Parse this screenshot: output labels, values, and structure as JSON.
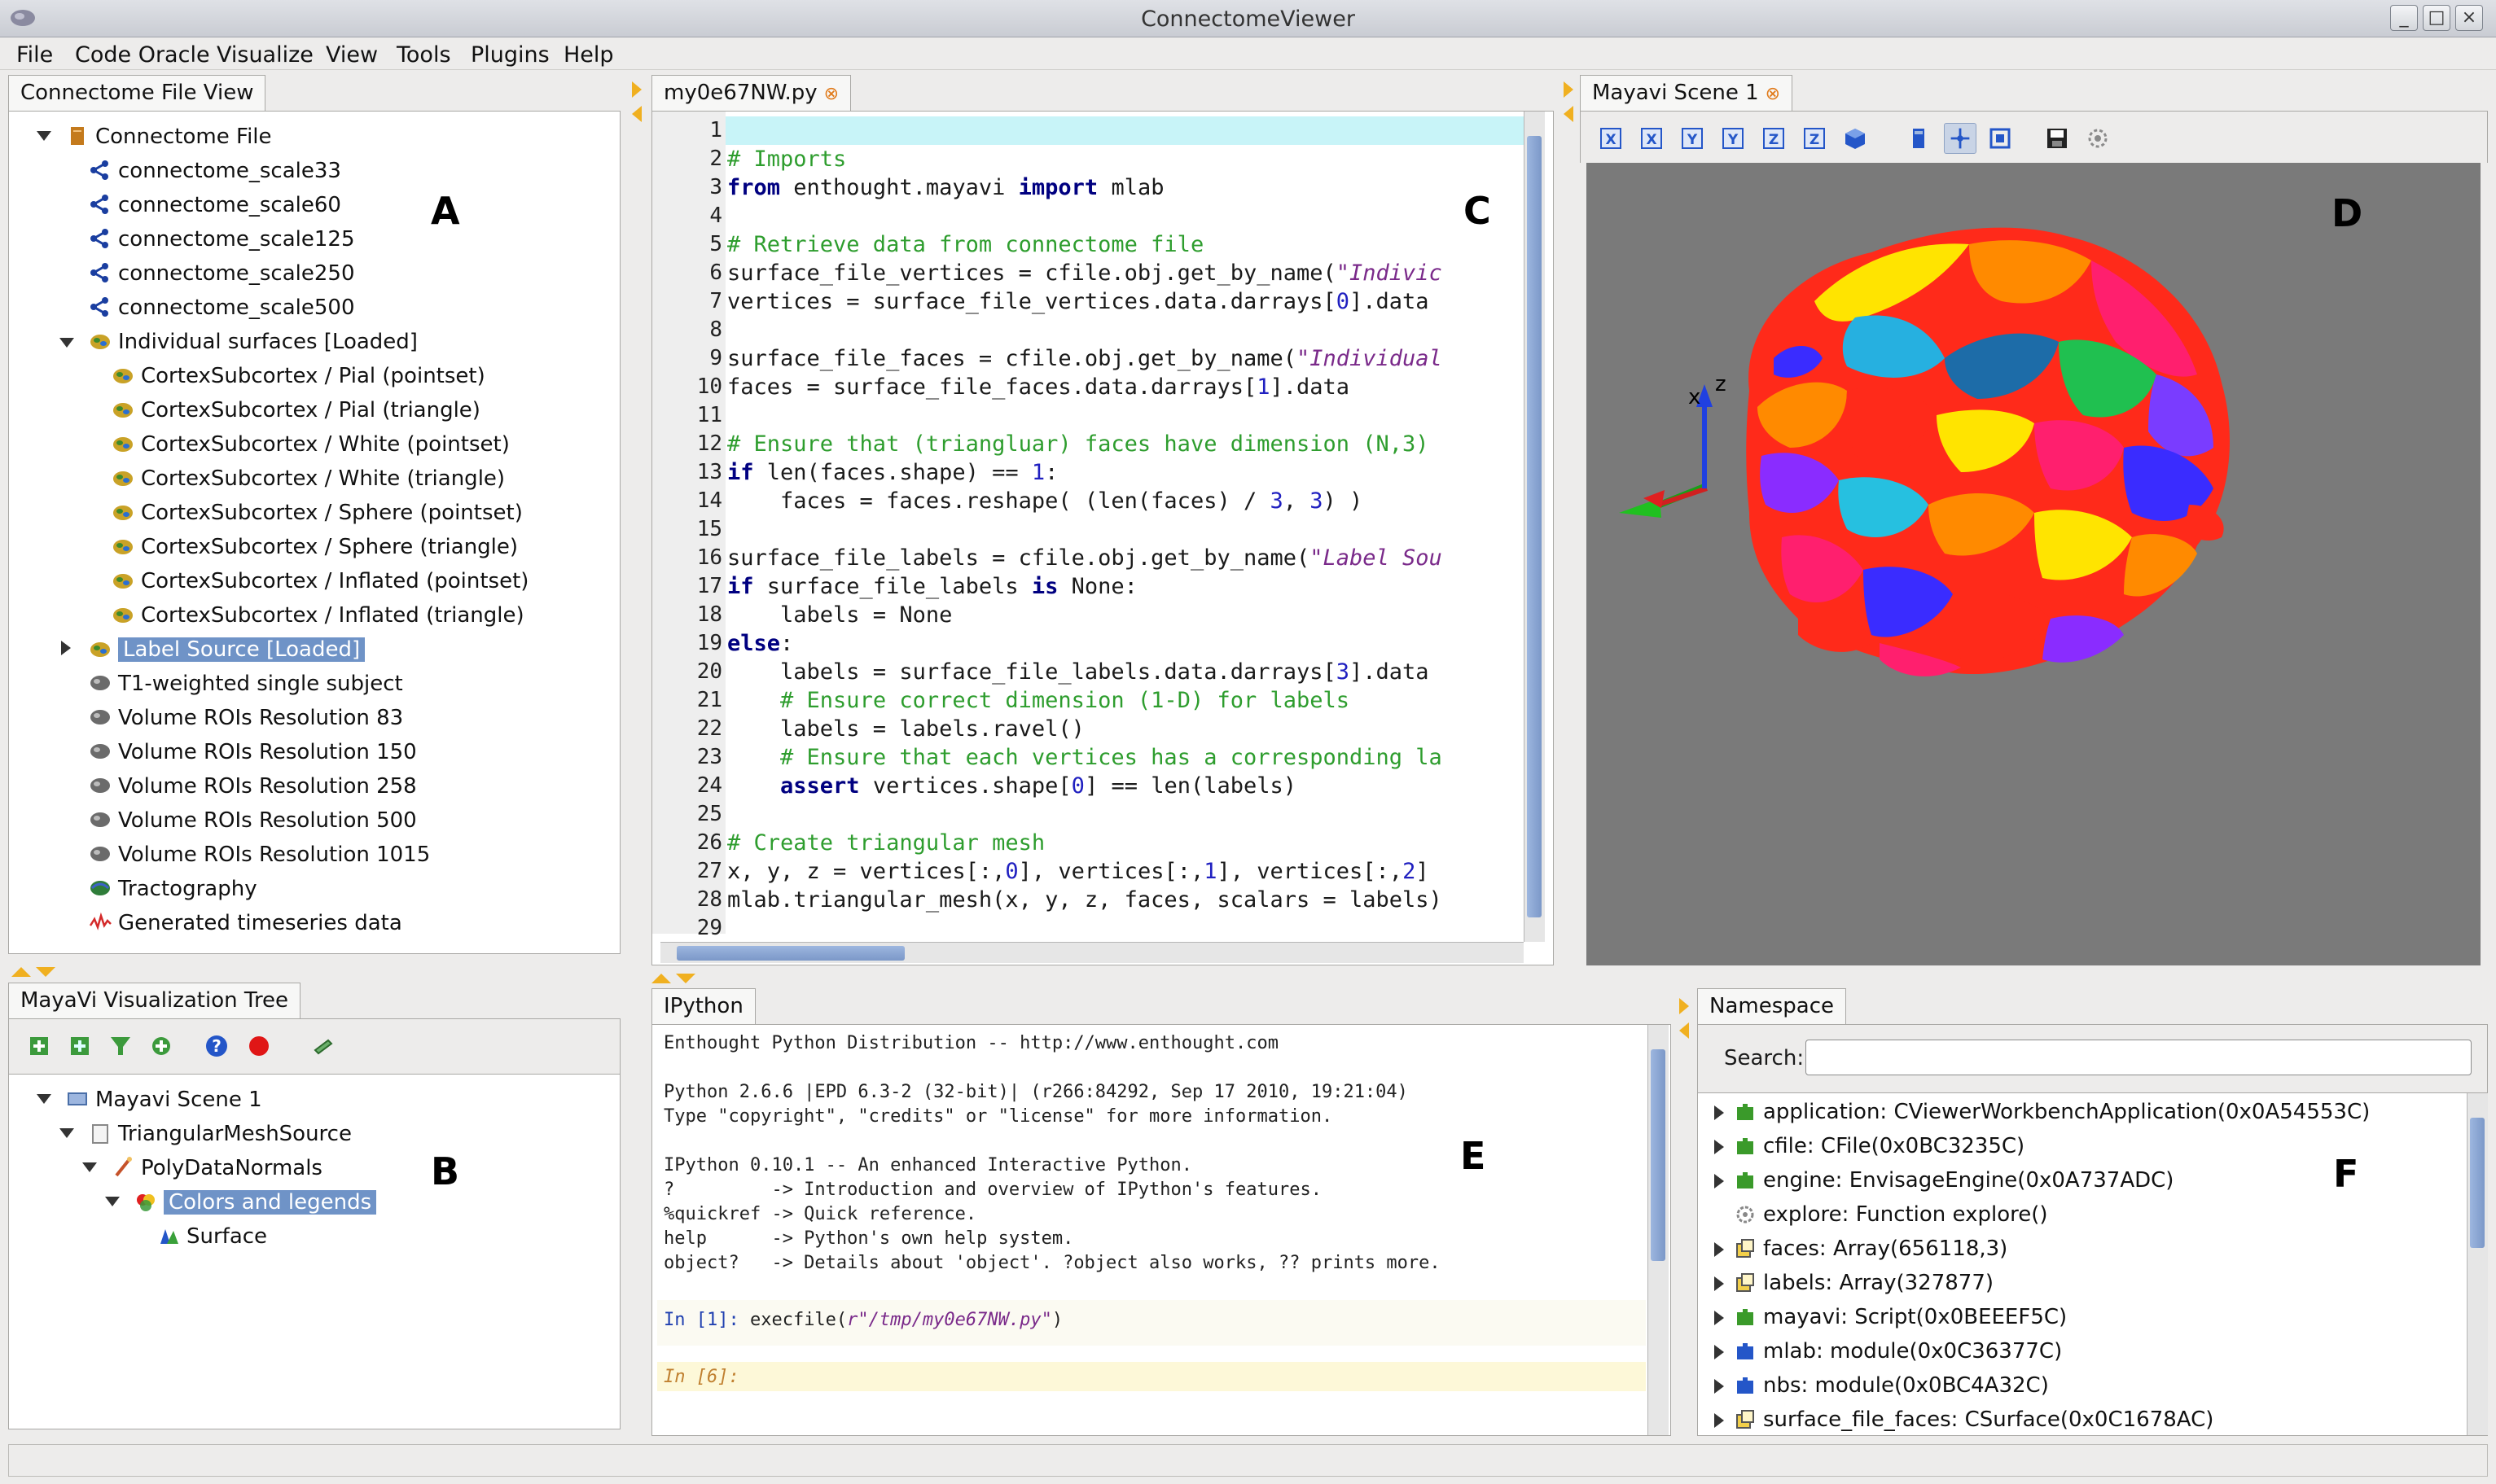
{
  "window": {
    "title": "ConnectomeViewer",
    "controls": [
      "_",
      "□",
      "×"
    ]
  },
  "menu": [
    "File",
    "Code Oracle",
    "Visualize",
    "View",
    "Tools",
    "Plugins",
    "Help"
  ],
  "panel_a": {
    "tab": "Connectome File View",
    "letter": "A",
    "root": "Connectome File",
    "networks": [
      "connectome_scale33",
      "connectome_scale60",
      "connectome_scale125",
      "connectome_scale250",
      "connectome_scale500"
    ],
    "surfaces_label": "Individual surfaces [Loaded]",
    "surfaces": [
      "CortexSubcortex / Pial (pointset)",
      "CortexSubcortex / Pial (triangle)",
      "CortexSubcortex / White (pointset)",
      "CortexSubcortex / White (triangle)",
      "CortexSubcortex / Sphere (pointset)",
      "CortexSubcortex / Sphere (triangle)",
      "CortexSubcortex / Inflated (pointset)",
      "CortexSubcortex / Inflated (triangle)"
    ],
    "label_source": "Label Source [Loaded]",
    "volumes": [
      "T1-weighted single subject",
      "Volume ROIs Resolution 83",
      "Volume ROIs Resolution 150",
      "Volume ROIs Resolution 258",
      "Volume ROIs Resolution 500",
      "Volume ROIs Resolution 1015"
    ],
    "tractography": "Tractography",
    "timeseries": "Generated timeseries data"
  },
  "panel_b": {
    "tab": "MayaVi Visualization Tree",
    "letter": "B",
    "items": [
      "Mayavi Scene 1",
      "TriangularMeshSource",
      "PolyDataNormals",
      "Colors and legends",
      "Surface"
    ]
  },
  "panel_c": {
    "tab": "my0e67NW.py",
    "tab_close": "⊗",
    "letter": "C",
    "line_numbers": [
      "1",
      "2",
      "3",
      "4",
      "5",
      "6",
      "7",
      "8",
      "9",
      "10",
      "11",
      "12",
      "13",
      "14",
      "15",
      "16",
      "17",
      "18",
      "19",
      "20",
      "21",
      "22",
      "23",
      "24",
      "25",
      "26",
      "27",
      "28",
      "29"
    ],
    "lines": [
      "",
      "# Imports",
      "from enthought.mayavi import mlab",
      "",
      "# Retrieve data from connectome file",
      "surface_file_vertices = cfile.obj.get_by_name(\"Indivic",
      "vertices = surface_file_vertices.data.darrays[0].data",
      "",
      "surface_file_faces = cfile.obj.get_by_name(\"Individual",
      "faces = surface_file_faces.data.darrays[1].data",
      "",
      "# Ensure that (triangluar) faces have dimension (N,3)",
      "if len(faces.shape) == 1:",
      "    faces = faces.reshape( (len(faces) / 3, 3) )",
      "",
      "surface_file_labels = cfile.obj.get_by_name(\"Label Sou",
      "if surface_file_labels is None:",
      "    labels = None",
      "else:",
      "    labels = surface_file_labels.data.darrays[3].data",
      "    # Ensure correct dimension (1-D) for labels",
      "    labels = labels.ravel()",
      "    # Ensure that each vertices has a corresponding la",
      "    assert vertices.shape[0] == len(labels)",
      "",
      "# Create triangular mesh",
      "x, y, z = vertices[:,0], vertices[:,1], vertices[:,2]",
      "mlab.triangular_mesh(x, y, z, faces, scalars = labels)",
      ""
    ]
  },
  "panel_d": {
    "tab": "Mayavi Scene 1",
    "tab_close": "⊗",
    "letter": "D",
    "axis_x": "x",
    "axis_z": "z"
  },
  "panel_e": {
    "tab": "IPython",
    "letter": "E",
    "lines": [
      "Enthought Python Distribution -- http://www.enthought.com",
      "",
      "Python 2.6.6 |EPD 6.3-2 (32-bit)| (r266:84292, Sep 17 2010, 19:21:04)",
      "Type \"copyright\", \"credits\" or \"license\" for more information.",
      "",
      "IPython 0.10.1 -- An enhanced Interactive Python.",
      "?         -> Introduction and overview of IPython's features.",
      "%quickref -> Quick reference.",
      "help      -> Python's own help system.",
      "object?   -> Details about 'object'. ?object also works, ?? prints more."
    ],
    "in1_prompt": "In [1]:",
    "in1_cmd": " execfile(",
    "in1_arg": "r\"/tmp/my0e67NW.py\"",
    "in1_close": ")",
    "in6_prompt": "In [6]:"
  },
  "panel_f": {
    "tab": "Namespace",
    "letter": "F",
    "search_label": "Search:",
    "search_value": "",
    "items": [
      "application: CViewerWorkbenchApplication(0x0A54553C)",
      "cfile: CFile(0x0BC3235C)",
      "engine: EnvisageEngine(0x0A737ADC)",
      "explore: Function explore()",
      "faces: Array(656118,3)",
      "labels: Array(327877)",
      "mayavi: Script(0x0BEEEF5C)",
      "mlab: module(0x0C36377C)",
      "nbs: module(0x0BC4A32C)",
      "surface_file_faces: CSurface(0x0C1678AC)"
    ]
  },
  "colors": {
    "selection": "#6f93c7",
    "comment": "#2e9d2e",
    "keyword": "#000080",
    "string": "#7a2a8a",
    "scene_bg": "#7a7a7a",
    "current_line": "#c8f4f8"
  }
}
